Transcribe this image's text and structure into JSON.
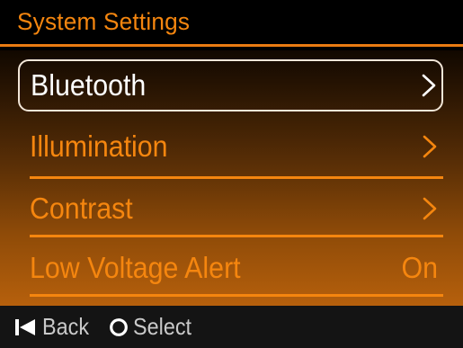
{
  "header": {
    "title": "System Settings"
  },
  "menu": {
    "items": [
      {
        "label": "Bluetooth",
        "trailing": "chevron-right-icon",
        "selected": true
      },
      {
        "label": "Illumination",
        "trailing": "chevron-right-icon",
        "selected": false
      },
      {
        "label": "Contrast",
        "trailing": "chevron-right-icon",
        "selected": false
      },
      {
        "label": "Low Voltage Alert",
        "value": "On",
        "selected": false
      }
    ]
  },
  "footer": {
    "back_label": "Back",
    "back_icon": "skip-back-icon",
    "select_label": "Select",
    "select_icon": "circle-select-icon"
  },
  "colors": {
    "accent": "#f5860f",
    "selected_text": "#ffffff",
    "selection_border": "#f2e6d8",
    "footer_text": "#c9c9c9",
    "background": "#000000"
  }
}
